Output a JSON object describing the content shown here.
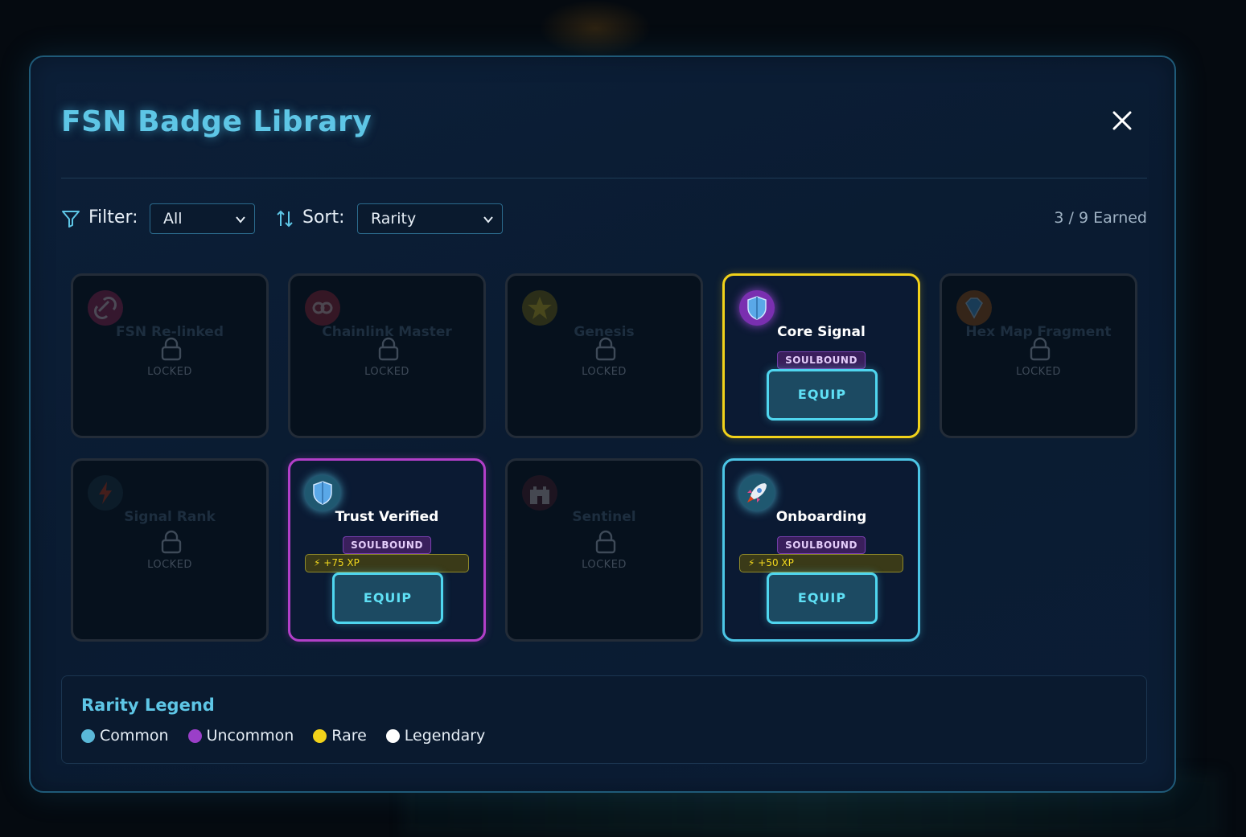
{
  "modal": {
    "title": "FSN Badge Library",
    "close_icon": "close-icon"
  },
  "toolbar": {
    "filter_label": "Filter:",
    "filter_value": "All",
    "sort_label": "Sort:",
    "sort_value": "Rarity",
    "earned_text": "3 / 9 Earned"
  },
  "badges": [
    {
      "name": "FSN Re-linked",
      "status": "LOCKED",
      "icon": "link-icon"
    },
    {
      "name": "Chainlink Master",
      "status": "LOCKED",
      "icon": "chain-icon"
    },
    {
      "name": "Genesis",
      "status": "LOCKED",
      "icon": "star-icon"
    },
    {
      "name": "Core Signal",
      "tag": "SOULBOUND",
      "action": "EQUIP",
      "rarity": "Rare",
      "icon": "shield-icon"
    },
    {
      "name": "Hex Map Fragment",
      "status": "LOCKED",
      "icon": "gem-icon"
    },
    {
      "name": "Signal Rank",
      "status": "LOCKED",
      "icon": "lightning-icon"
    },
    {
      "name": "Trust Verified",
      "tag": "SOULBOUND",
      "xp": "+75 XP",
      "action": "EQUIP",
      "rarity": "Uncommon",
      "icon": "shield-icon"
    },
    {
      "name": "Sentinel",
      "status": "LOCKED",
      "icon": "castle-icon"
    },
    {
      "name": "Onboarding",
      "tag": "SOULBOUND",
      "xp": "+50 XP",
      "action": "EQUIP",
      "rarity": "Common",
      "icon": "rocket-icon"
    }
  ],
  "legend": {
    "title": "Rarity Legend",
    "items": [
      {
        "label": "Common",
        "color": "#5ab8d8"
      },
      {
        "label": "Uncommon",
        "color": "#9a3fc8"
      },
      {
        "label": "Rare",
        "color": "#f2d21a"
      },
      {
        "label": "Legendary",
        "color": "#ffffff"
      }
    ]
  },
  "colors": {
    "accent": "#5ec6e6",
    "rare_border": "#f2d21a",
    "uncommon_border": "#b23fc8",
    "common_border": "#4cc6e6"
  }
}
